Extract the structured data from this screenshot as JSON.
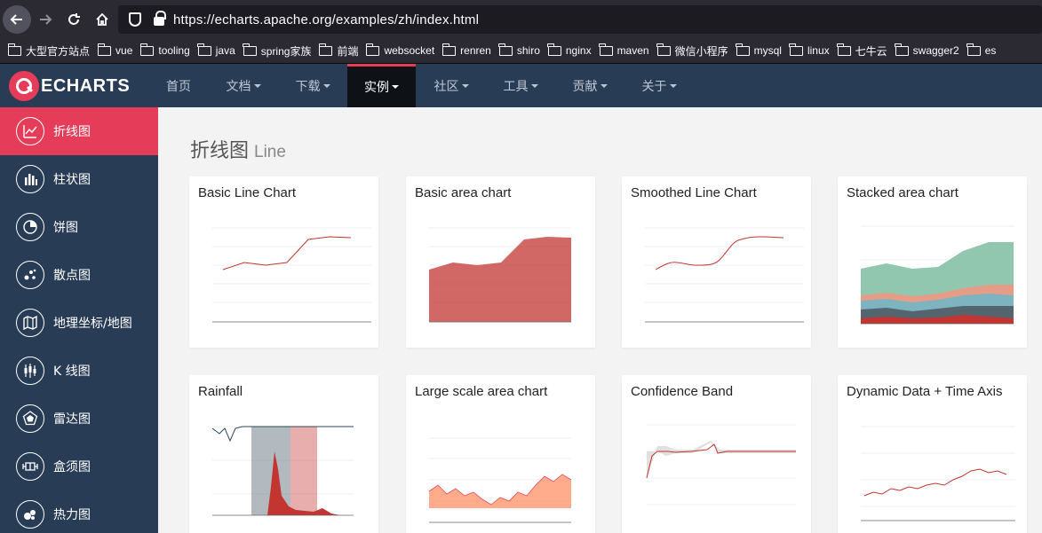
{
  "browser": {
    "url": "https://echarts.apache.org/examples/zh/index.html",
    "bookmarks": [
      "大型官方站点",
      "vue",
      "tooling",
      "java",
      "spring家族",
      "前端",
      "websocket",
      "renren",
      "shiro",
      "nginx",
      "maven",
      "微信小程序",
      "mysql",
      "linux",
      "七牛云",
      "swagger2",
      "es"
    ]
  },
  "header": {
    "logo_text": "ECHARTS",
    "nav": [
      {
        "label": "首页"
      },
      {
        "label": "文档"
      },
      {
        "label": "下载"
      },
      {
        "label": "实例"
      },
      {
        "label": "社区"
      },
      {
        "label": "工具"
      },
      {
        "label": "贡献"
      },
      {
        "label": "关于"
      }
    ]
  },
  "sidebar": {
    "items": [
      {
        "label": "折线图",
        "icon": "line-chart-icon"
      },
      {
        "label": "柱状图",
        "icon": "bar-chart-icon"
      },
      {
        "label": "饼图",
        "icon": "pie-chart-icon"
      },
      {
        "label": "散点图",
        "icon": "scatter-chart-icon"
      },
      {
        "label": "地理坐标/地图",
        "icon": "map-icon"
      },
      {
        "label": "K 线图",
        "icon": "candlestick-icon"
      },
      {
        "label": "雷达图",
        "icon": "radar-icon"
      },
      {
        "label": "盒须图",
        "icon": "boxplot-icon"
      },
      {
        "label": "热力图",
        "icon": "heatmap-icon"
      }
    ]
  },
  "main": {
    "section_title": "折线图",
    "section_title_en": "Line",
    "cards": [
      {
        "title": "Basic Line Chart"
      },
      {
        "title": "Basic area chart"
      },
      {
        "title": "Smoothed Line Chart"
      },
      {
        "title": "Stacked area chart"
      },
      {
        "title": "Rainfall"
      },
      {
        "title": "Large scale area chart"
      },
      {
        "title": "Confidence Band"
      },
      {
        "title": "Dynamic Data + Time Axis"
      }
    ]
  },
  "colors": {
    "brand_red": "#e43c59",
    "nav_bg": "#293c55",
    "chart_red": "#c23531"
  }
}
